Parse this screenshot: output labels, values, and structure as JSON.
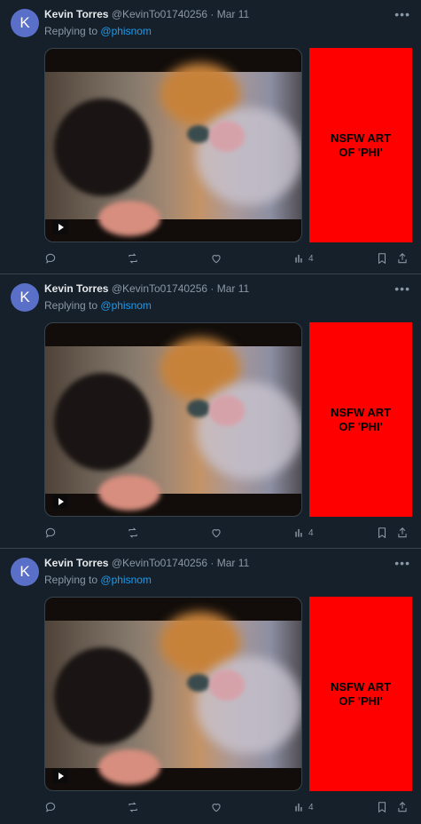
{
  "tweets": [
    {
      "avatar_letter": "K",
      "name": "Kevin Torres",
      "handle": "@KevinTo01740256",
      "separator": "·",
      "date": "Mar 11",
      "reply_prefix": "Replying to",
      "reply_to": "@phisnom",
      "nsfw_text": "NSFW ART OF 'PHI'",
      "views": "4"
    },
    {
      "avatar_letter": "K",
      "name": "Kevin Torres",
      "handle": "@KevinTo01740256",
      "separator": "·",
      "date": "Mar 11",
      "reply_prefix": "Replying to",
      "reply_to": "@phisnom",
      "nsfw_text": "NSFW ART OF 'PHI'",
      "views": "4"
    },
    {
      "avatar_letter": "K",
      "name": "Kevin Torres",
      "handle": "@KevinTo01740256",
      "separator": "·",
      "date": "Mar 11",
      "reply_prefix": "Replying to",
      "reply_to": "@phisnom",
      "nsfw_text": "NSFW ART OF 'PHI'",
      "views": "4"
    }
  ],
  "icons": {
    "more": "more-horizontal-icon",
    "reply": "reply-icon",
    "retweet": "retweet-icon",
    "like": "heart-icon",
    "views": "views-bar-chart-icon",
    "bookmark": "bookmark-icon",
    "share": "share-icon",
    "play": "play-icon"
  },
  "colors": {
    "background": "#15202b",
    "link": "#1d9bf0",
    "muted": "#8b98a5",
    "nsfw_block": "#ff0000",
    "avatar": "#5a6fc8"
  }
}
